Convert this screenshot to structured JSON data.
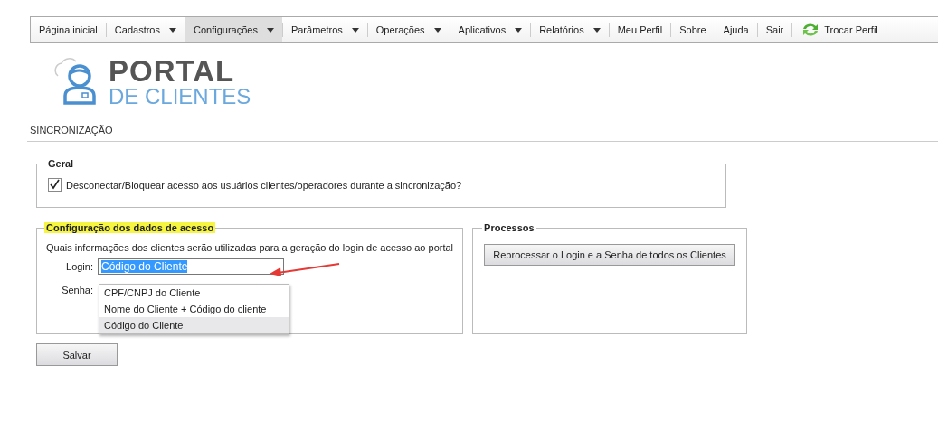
{
  "nav": [
    {
      "label": "Página inicial",
      "dropdown": false,
      "selected": false
    },
    {
      "label": "Cadastros",
      "dropdown": true,
      "selected": false
    },
    {
      "label": "Configurações",
      "dropdown": true,
      "selected": true
    },
    {
      "label": "Parâmetros",
      "dropdown": true,
      "selected": false
    },
    {
      "label": "Operações",
      "dropdown": true,
      "selected": false
    },
    {
      "label": "Aplicativos",
      "dropdown": true,
      "selected": false
    },
    {
      "label": "Relatórios",
      "dropdown": true,
      "selected": false
    },
    {
      "label": "Meu Perfil",
      "dropdown": false,
      "selected": false
    },
    {
      "label": "Sobre",
      "dropdown": false,
      "selected": false
    },
    {
      "label": "Ajuda",
      "dropdown": false,
      "selected": false
    },
    {
      "label": "Sair",
      "dropdown": false,
      "selected": false
    }
  ],
  "switch_profile": {
    "label": "Trocar Perfil"
  },
  "logo": {
    "line1": "PORTAL",
    "line2": "DE CLIENTES"
  },
  "page_title": "SINCRONIZAÇÃO",
  "general": {
    "legend": "Geral",
    "checkbox": {
      "label": "Desconectar/Bloquear acesso aos usuários clientes/operadores durante a sincronização?",
      "checked": true
    }
  },
  "access": {
    "legend": "Configuração dos dados de acesso",
    "highlighted": true,
    "description": "Quais informações dos clientes serão utilizadas para a geração do login de acesso ao portal",
    "login": {
      "label": "Login:",
      "value": "Código do Cliente",
      "options": [
        {
          "label": "CPF/CNPJ do Cliente",
          "selected": false
        },
        {
          "label": "Nome do Cliente + Código do cliente",
          "selected": false
        },
        {
          "label": "Código do Cliente",
          "selected": true
        }
      ]
    },
    "password": {
      "label": "Senha:"
    }
  },
  "processes": {
    "legend": "Processos",
    "button": "Reprocessar o Login e a Senha de todos os Clientes"
  },
  "save_button": "Salvar"
}
